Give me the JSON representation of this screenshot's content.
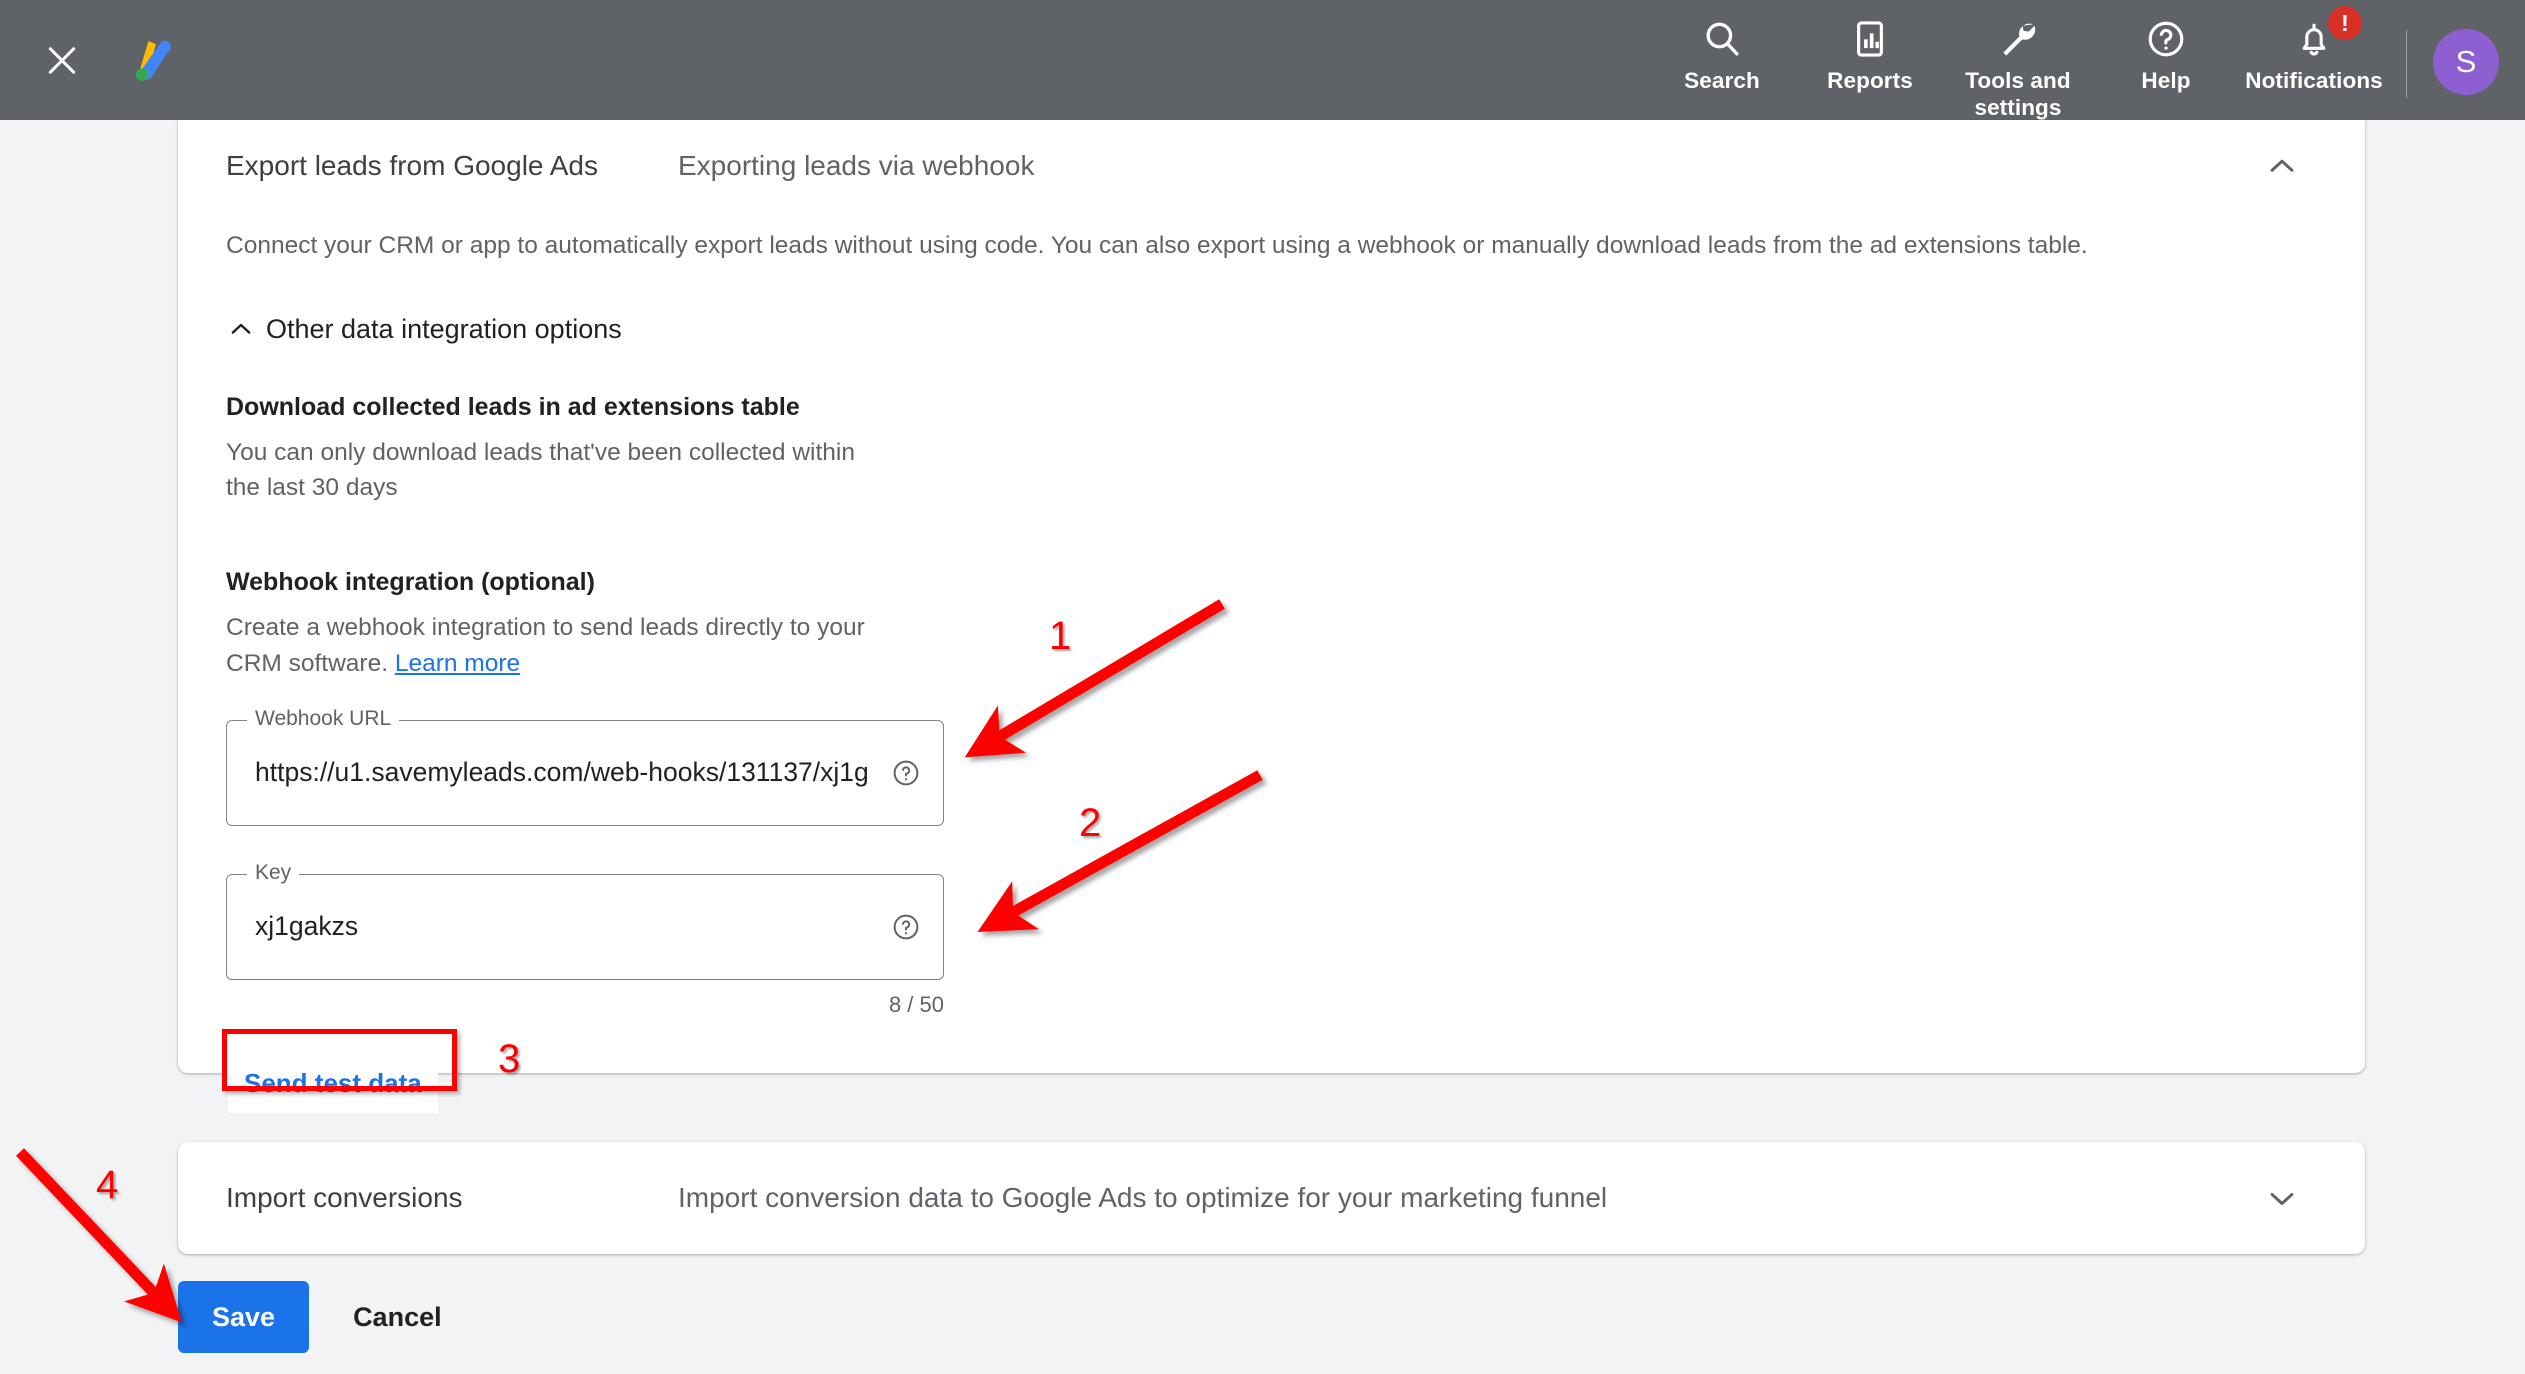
{
  "appbar": {
    "close_label": "close-icon",
    "logo_label": "google-ads-logo",
    "nav": [
      {
        "label": "Search",
        "icon": "search-icon"
      },
      {
        "label": "Reports",
        "icon": "reports-icon"
      },
      {
        "label": "Tools and settings",
        "icon": "tools-icon"
      },
      {
        "label": "Help",
        "icon": "help-icon"
      },
      {
        "label": "Notifications",
        "icon": "bell-icon",
        "badge": "!"
      }
    ],
    "avatar_initial": "S"
  },
  "webhook_card": {
    "title": "Export leads from Google Ads",
    "subtitle": "Exporting leads via webhook",
    "collapse_icon": "chevron-up-icon",
    "intro": "Connect your CRM or app to automatically export leads without using code. You can also export using a webhook or manually download leads from the ad extensions table.",
    "other_options_label": "Other data integration options",
    "download_section": {
      "title": "Download collected leads in ad extensions table",
      "description": "You can only download leads that've been collected within the last 30 days"
    },
    "webhook_section": {
      "title": "Webhook integration (optional)",
      "description_before_link": "Create a webhook integration to send leads directly to your CRM software. ",
      "link_text": "Learn more"
    },
    "url_field": {
      "legend": "Webhook URL",
      "value": "https://u1.savemyleads.com/web-hooks/131137/xj1g",
      "help_icon": "help-circle-icon"
    },
    "key_field": {
      "legend": "Key",
      "value": "xj1gakzs",
      "help_icon": "help-circle-icon",
      "counter": "8 / 50"
    },
    "send_test_label": "Send test data"
  },
  "import_card": {
    "title": "Import conversions",
    "subtitle": "Import conversion data to Google Ads to optimize for your marketing funnel",
    "expand_icon": "chevron-down-icon"
  },
  "footer": {
    "save_label": "Save",
    "cancel_label": "Cancel"
  },
  "annotations": {
    "accent_color": "#ff0000",
    "steps": [
      "1",
      "2",
      "3",
      "4"
    ]
  }
}
